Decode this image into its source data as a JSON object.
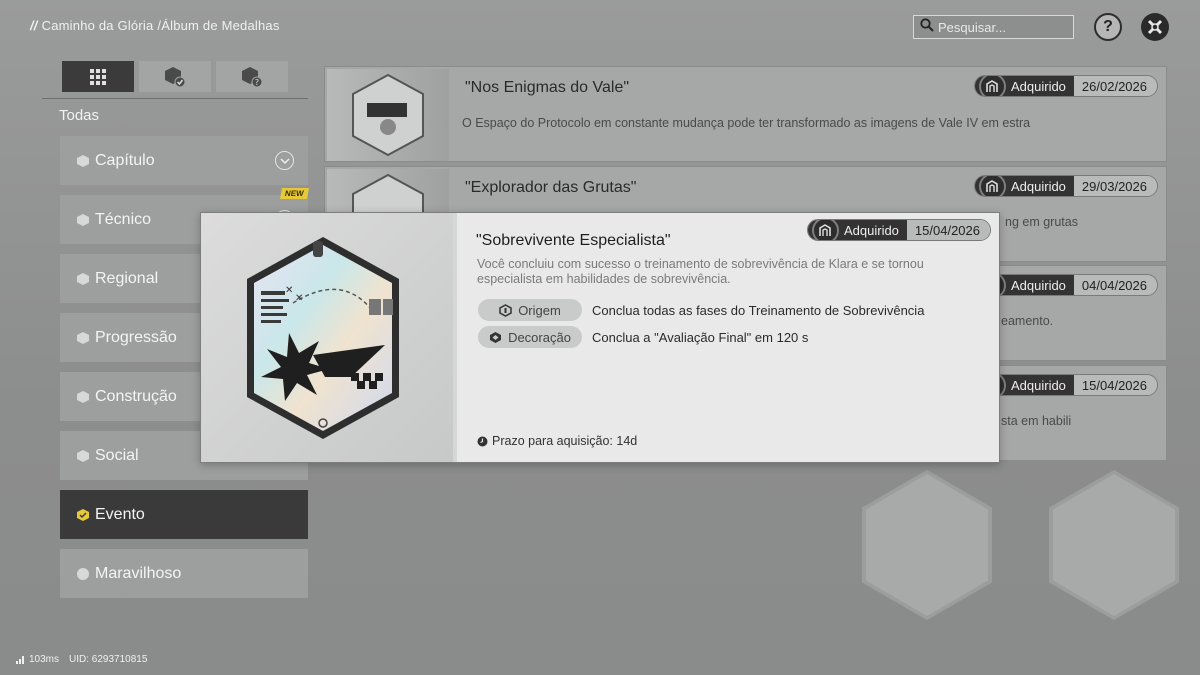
{
  "breadcrumb": {
    "slashes": "//",
    "section": "Caminho da Glória",
    "separator": "/",
    "page": "Álbum de Medalhas"
  },
  "search": {
    "placeholder": "Pesquisar..."
  },
  "header": {
    "help_label": "?"
  },
  "sidebar": {
    "all_label": "Todas",
    "tabs": [
      {
        "icon": "grid-icon"
      },
      {
        "icon": "medal-check-icon"
      },
      {
        "icon": "medal-question-icon"
      }
    ],
    "categories": [
      {
        "label": "Capítulo",
        "icon": "chapter-icon"
      },
      {
        "label": "Técnico",
        "icon": "technical-icon",
        "badge": "NEW"
      },
      {
        "label": "Regional",
        "icon": "regional-icon"
      },
      {
        "label": "Progressão",
        "icon": "progression-icon"
      },
      {
        "label": "Construção",
        "icon": "construction-icon"
      },
      {
        "label": "Social",
        "icon": "social-icon"
      },
      {
        "label": "Evento",
        "icon": "event-icon",
        "active": true
      },
      {
        "label": "Maravilhoso",
        "icon": "wonderful-icon"
      }
    ]
  },
  "medals": [
    {
      "title": "\"Nos Enigmas do Vale\"",
      "description": "O Espaço do Protocolo em constante mudança pode ter transformado as imagens de Vale IV em estra",
      "status": "Adquirido",
      "date": "26/02/2026"
    },
    {
      "title": "\"Explorador das Grutas\"",
      "description": "ng em grutas",
      "status": "Adquirido",
      "date": "29/03/2026"
    },
    {
      "title": "",
      "description": "eamento.",
      "status": "Adquirido",
      "date": "04/04/2026"
    },
    {
      "title": "",
      "description": "sta em habili",
      "status": "Adquirido",
      "date": "15/04/2026"
    }
  ],
  "modal": {
    "title": "\"Sobrevivente Especialista\"",
    "description": "Você concluiu com sucesso o treinamento de sobrevivência de Klara e se tornou especialista em habilidades de sobrevivência.",
    "status": "Adquirido",
    "date": "15/04/2026",
    "requirements": [
      {
        "label": "Origem",
        "icon": "origin-icon",
        "text": "Conclua todas as fases do Treinamento de Sobrevivência"
      },
      {
        "label": "Decoração",
        "icon": "decoration-icon",
        "text": "Conclua a \"Avaliação Final\" em 120 s"
      }
    ],
    "deadline": "Prazo para aquisição: 14d"
  },
  "footer": {
    "ping": "103ms",
    "uid": "UID: 6293710815"
  },
  "colors": {
    "accent": "#e6c93b",
    "dark": "#333333",
    "panel": "#e9e9e9"
  }
}
